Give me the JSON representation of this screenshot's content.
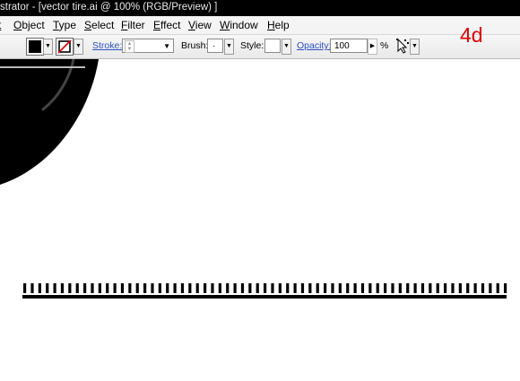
{
  "window": {
    "title": "strator - [vector tire.ai @ 100% (RGB/Preview) ]"
  },
  "menu": {
    "items": [
      "t",
      "Object",
      "Type",
      "Select",
      "Filter",
      "Effect",
      "View",
      "Window",
      "Help"
    ]
  },
  "toolbar": {
    "fill_color": "#000000",
    "stroke_label": "Stroke:",
    "stroke_weight": "",
    "brush_label": "Brush:",
    "brush_value": "·",
    "style_label": "Style:",
    "opacity_label": "Opacity:",
    "opacity_value": "100",
    "opacity_unit": "%"
  },
  "annotation": {
    "step_label": "4d",
    "color": "#e00000"
  },
  "canvas": {
    "tick_count": 65,
    "shape_color": "#000000"
  }
}
